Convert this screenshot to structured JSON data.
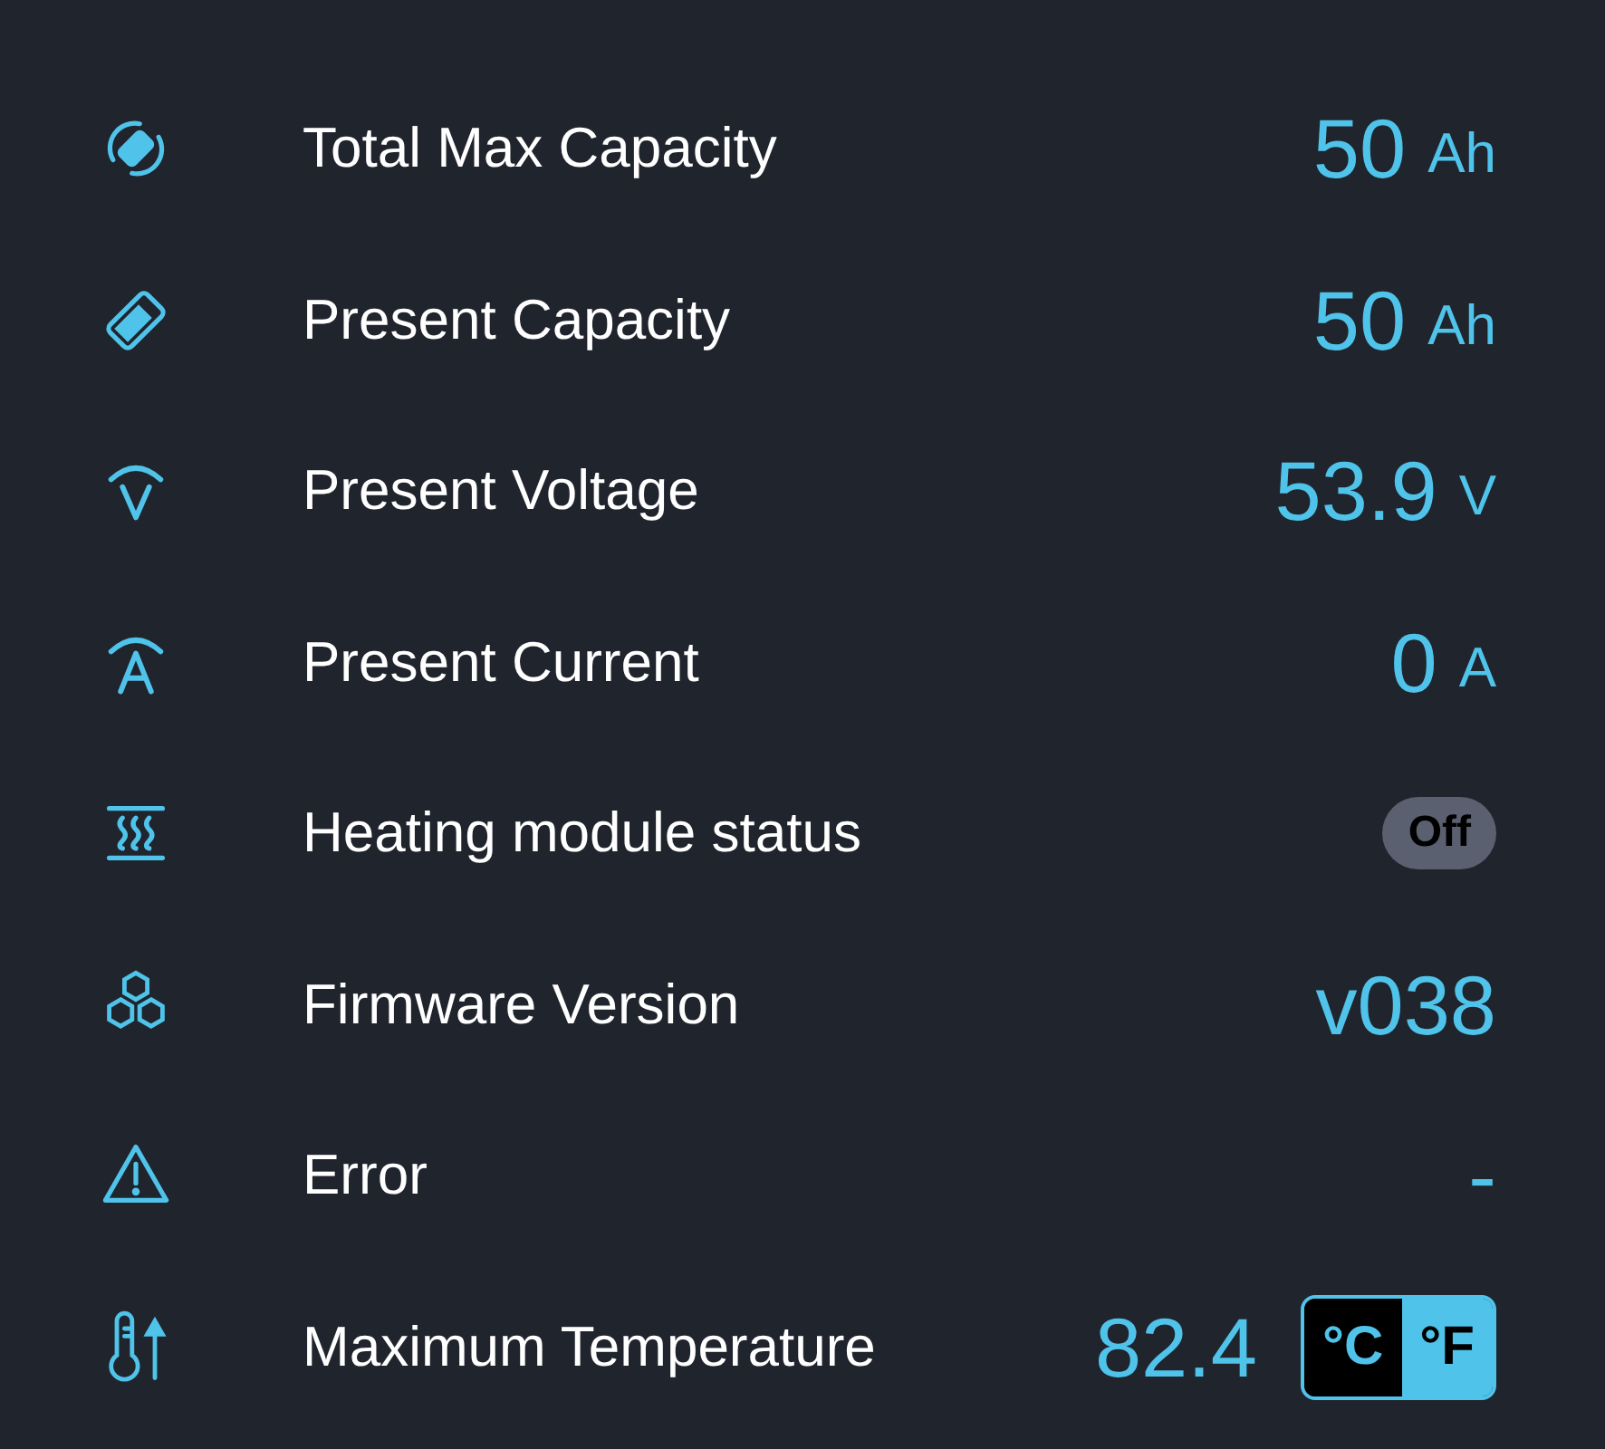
{
  "rows": [
    {
      "label": "Total Max Capacity",
      "kind": "measure",
      "value": "50",
      "unit": "Ah"
    },
    {
      "label": "Present Capacity",
      "kind": "measure",
      "value": "50",
      "unit": "Ah"
    },
    {
      "label": "Present Voltage",
      "kind": "measure",
      "value": "53.9",
      "unit": "V"
    },
    {
      "label": "Present Current",
      "kind": "measure",
      "value": "0",
      "unit": "A"
    },
    {
      "label": "Heating module status",
      "kind": "status",
      "status": "Off",
      "on": false
    },
    {
      "label": "Firmware Version",
      "kind": "measure",
      "value": "v038"
    },
    {
      "label": "Error",
      "kind": "measure",
      "value": "-"
    },
    {
      "label": "Maximum Temperature",
      "kind": "temperature",
      "value": "82.4",
      "units": [
        {
          "label": "°C",
          "selected": false
        },
        {
          "label": "°F",
          "selected": true
        }
      ]
    }
  ]
}
